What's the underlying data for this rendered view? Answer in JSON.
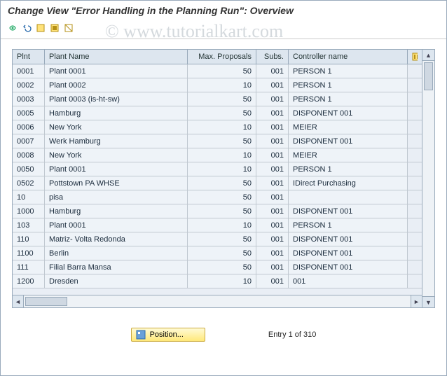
{
  "title": "Change View \"Error Handling in the Planning Run\": Overview",
  "watermark": "© www.tutorialkart.com",
  "toolbar_icons": [
    "other-view",
    "undo",
    "select-all",
    "select-block",
    "deselect-all"
  ],
  "columns": {
    "plnt": "Plnt",
    "plant_name": "Plant Name",
    "max_proposals": "Max. Proposals",
    "subs": "Subs.",
    "controller_name": "Controller name"
  },
  "rows": [
    {
      "plnt": "0001",
      "name": "Plant 0001",
      "max": "50",
      "subs": "001",
      "ctrl": "PERSON 1"
    },
    {
      "plnt": "0002",
      "name": "Plant 0002",
      "max": "10",
      "subs": "001",
      "ctrl": "PERSON 1"
    },
    {
      "plnt": "0003",
      "name": "Plant 0003 (is-ht-sw)",
      "max": "50",
      "subs": "001",
      "ctrl": "PERSON 1"
    },
    {
      "plnt": "0005",
      "name": "Hamburg",
      "max": "50",
      "subs": "001",
      "ctrl": "DISPONENT 001"
    },
    {
      "plnt": "0006",
      "name": "New York",
      "max": "10",
      "subs": "001",
      "ctrl": "MEIER"
    },
    {
      "plnt": "0007",
      "name": "Werk Hamburg",
      "max": "50",
      "subs": "001",
      "ctrl": "DISPONENT 001"
    },
    {
      "plnt": "0008",
      "name": "New York",
      "max": "10",
      "subs": "001",
      "ctrl": "MEIER"
    },
    {
      "plnt": "0050",
      "name": "Plant 0001",
      "max": "10",
      "subs": "001",
      "ctrl": "PERSON 1"
    },
    {
      "plnt": "0502",
      "name": "Pottstown PA WHSE",
      "max": "50",
      "subs": "001",
      "ctrl": "IDirect Purchasing"
    },
    {
      "plnt": "10",
      "name": "pisa",
      "max": "50",
      "subs": "001",
      "ctrl": ""
    },
    {
      "plnt": "1000",
      "name": "Hamburg",
      "max": "50",
      "subs": "001",
      "ctrl": "DISPONENT 001"
    },
    {
      "plnt": "103",
      "name": "Plant 0001",
      "max": "10",
      "subs": "001",
      "ctrl": "PERSON 1"
    },
    {
      "plnt": "110",
      "name": "Matriz- Volta Redonda",
      "max": "50",
      "subs": "001",
      "ctrl": "DISPONENT 001"
    },
    {
      "plnt": "1100",
      "name": "Berlin",
      "max": "50",
      "subs": "001",
      "ctrl": "DISPONENT 001"
    },
    {
      "plnt": "111",
      "name": "Filial Barra Mansa",
      "max": "50",
      "subs": "001",
      "ctrl": "DISPONENT 001"
    },
    {
      "plnt": "1200",
      "name": "Dresden",
      "max": "10",
      "subs": "001",
      "ctrl": "001"
    }
  ],
  "footer": {
    "position_label": "Position...",
    "entry_label": "Entry 1 of 310"
  }
}
